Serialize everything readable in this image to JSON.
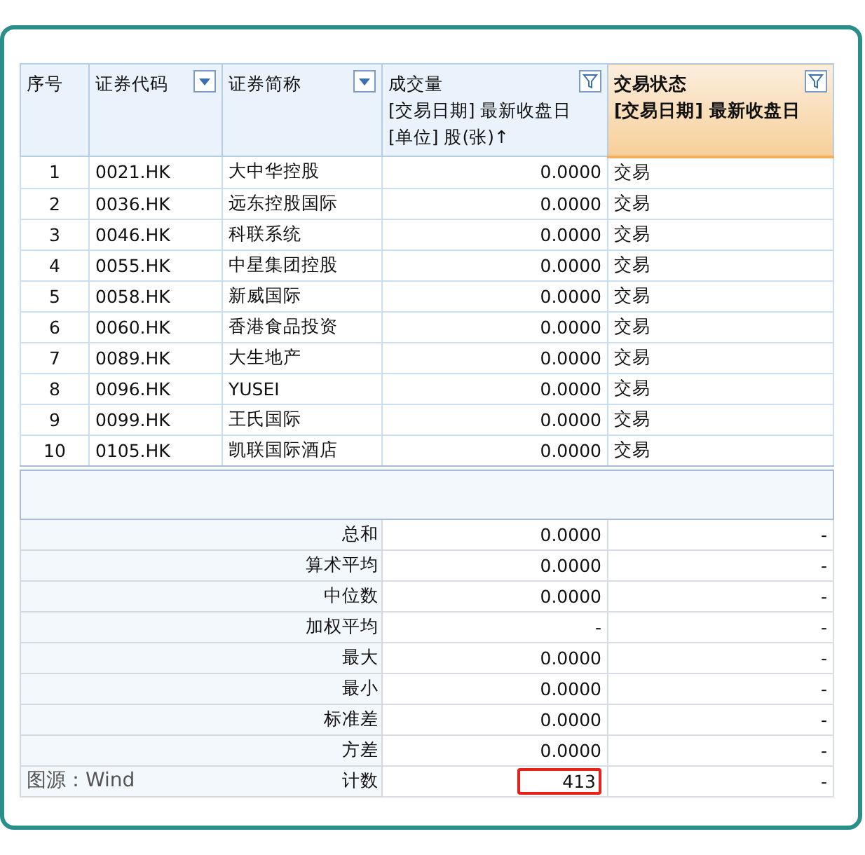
{
  "table": {
    "columns": [
      {
        "lines": [
          "序号"
        ],
        "kind": "plain",
        "selected": false
      },
      {
        "lines": [
          "证券代码"
        ],
        "kind": "dropdown",
        "selected": false
      },
      {
        "lines": [
          "证券简称"
        ],
        "kind": "dropdown",
        "selected": false
      },
      {
        "lines": [
          "成交量",
          "[交易日期] 最新收盘日",
          "[单位] 股(张)↑"
        ],
        "kind": "funnel",
        "selected": false
      },
      {
        "lines": [
          "交易状态",
          "[交易日期] 最新收盘日"
        ],
        "kind": "funnel",
        "selected": true
      }
    ],
    "rows": [
      [
        "1",
        "0021.HK",
        "大中华控股",
        "0.0000",
        "交易"
      ],
      [
        "2",
        "0036.HK",
        "远东控股国际",
        "0.0000",
        "交易"
      ],
      [
        "3",
        "0046.HK",
        "科联系统",
        "0.0000",
        "交易"
      ],
      [
        "4",
        "0055.HK",
        "中星集团控股",
        "0.0000",
        "交易"
      ],
      [
        "5",
        "0058.HK",
        "新威国际",
        "0.0000",
        "交易"
      ],
      [
        "6",
        "0060.HK",
        "香港食品投资",
        "0.0000",
        "交易"
      ],
      [
        "7",
        "0089.HK",
        "大生地产",
        "0.0000",
        "交易"
      ],
      [
        "8",
        "0096.HK",
        "YUSEI",
        "0.0000",
        "交易"
      ],
      [
        "9",
        "0099.HK",
        "王氏国际",
        "0.0000",
        "交易"
      ],
      [
        "10",
        "0105.HK",
        "凯联国际酒店",
        "0.0000",
        "交易"
      ]
    ],
    "summary": [
      {
        "label": "总和",
        "value": "0.0000",
        "status": "-",
        "highlighted": false
      },
      {
        "label": "算术平均",
        "value": "0.0000",
        "status": "-",
        "highlighted": false
      },
      {
        "label": "中位数",
        "value": "0.0000",
        "status": "-",
        "highlighted": false
      },
      {
        "label": "加权平均",
        "value": "-",
        "status": "-",
        "highlighted": false
      },
      {
        "label": "最大",
        "value": "0.0000",
        "status": "-",
        "highlighted": false
      },
      {
        "label": "最小",
        "value": "0.0000",
        "status": "-",
        "highlighted": false
      },
      {
        "label": "标准差",
        "value": "0.0000",
        "status": "-",
        "highlighted": false
      },
      {
        "label": "方差",
        "value": "0.0000",
        "status": "-",
        "highlighted": false
      },
      {
        "label": "计数",
        "value": "413",
        "status": "-",
        "highlighted": true
      }
    ]
  },
  "source": "图源：Wind"
}
